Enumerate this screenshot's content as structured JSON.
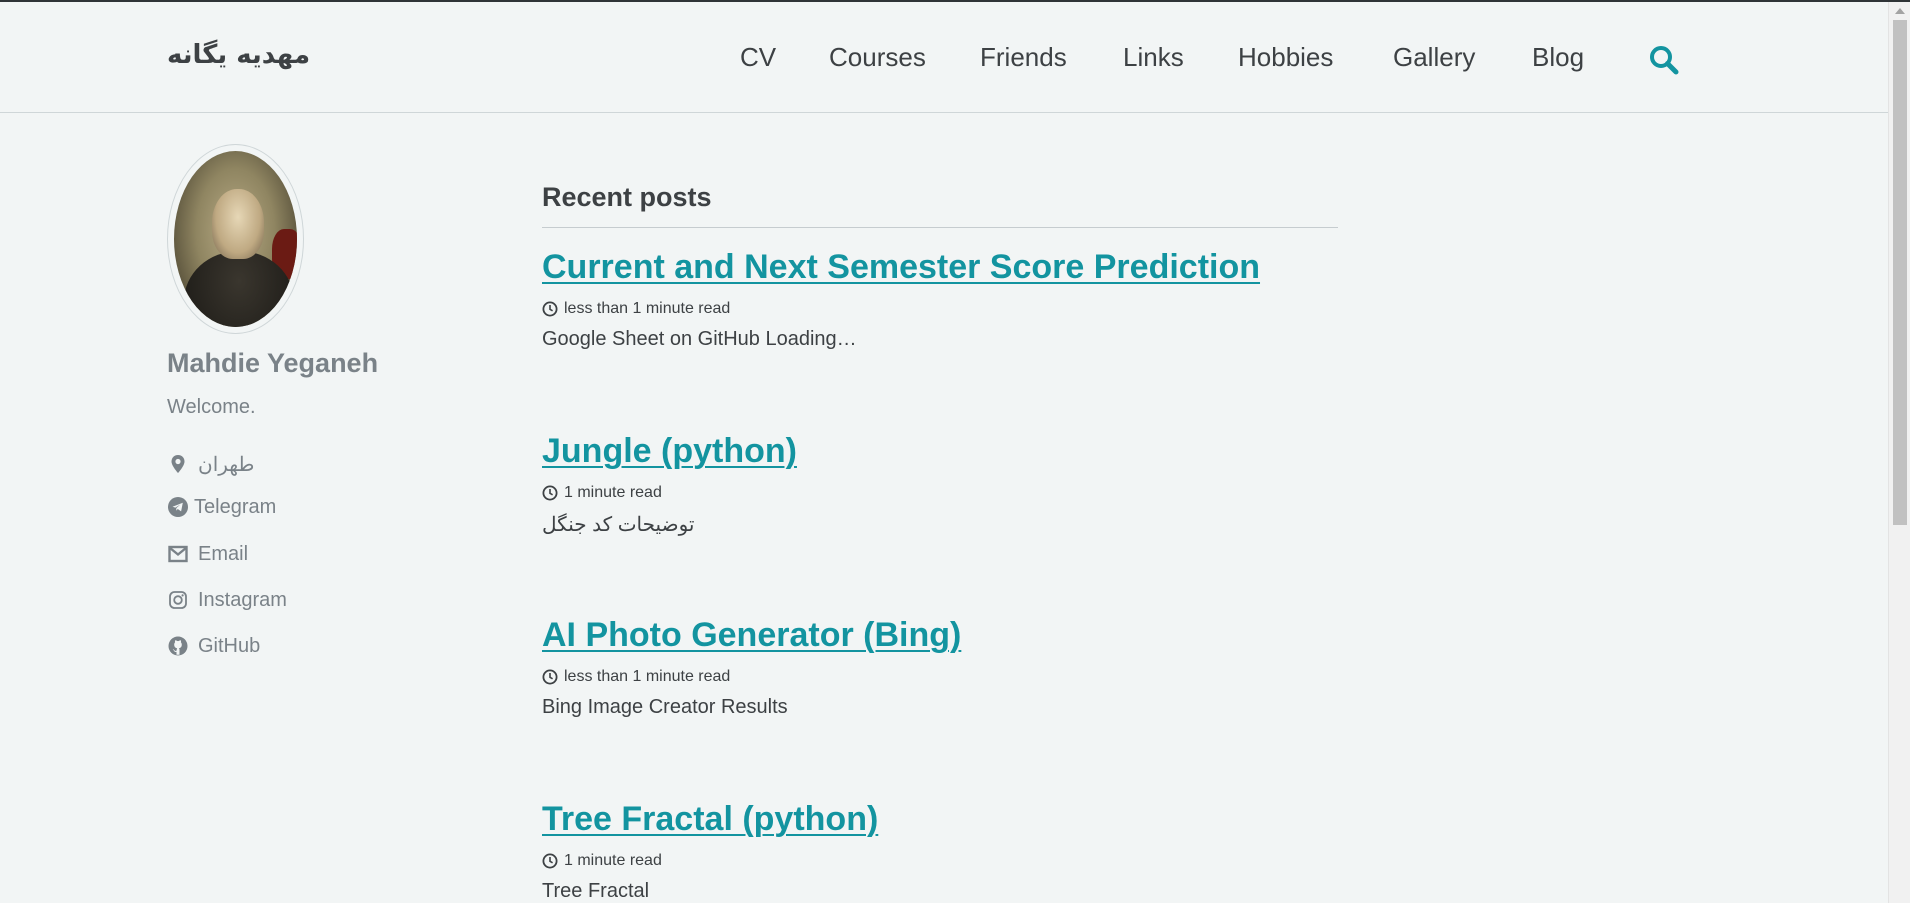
{
  "site": {
    "title": "مهدیه یگانه"
  },
  "nav": {
    "items": [
      {
        "label": "CV"
      },
      {
        "label": "Courses"
      },
      {
        "label": "Friends"
      },
      {
        "label": "Links"
      },
      {
        "label": "Hobbies"
      },
      {
        "label": "Gallery"
      },
      {
        "label": "Blog"
      }
    ],
    "search_icon": "search-icon"
  },
  "author": {
    "name": "Mahdie Yeganeh",
    "bio": "Welcome.",
    "links": [
      {
        "icon": "map-marker-icon",
        "label": "طهران"
      },
      {
        "icon": "telegram-icon",
        "label": "Telegram"
      },
      {
        "icon": "envelope-icon",
        "label": "Email"
      },
      {
        "icon": "instagram-icon",
        "label": "Instagram"
      },
      {
        "icon": "github-icon",
        "label": "GitHub"
      }
    ]
  },
  "main": {
    "section_title": "Recent posts",
    "posts": [
      {
        "title": "Current and Next Semester Score Prediction",
        "read_time": "less than 1 minute read",
        "excerpt": "Google Sheet on GitHub Loading…"
      },
      {
        "title": "Jungle (python)",
        "read_time": "1 minute read",
        "excerpt": "توضیحات کد جنگل"
      },
      {
        "title": "AI Photo Generator (Bing)",
        "read_time": "less than 1 minute read",
        "excerpt": "Bing Image Creator Results"
      },
      {
        "title": "Tree Fractal (python)",
        "read_time": "1 minute read",
        "excerpt": "Tree Fractal"
      }
    ]
  },
  "colors": {
    "background": "#f2f5f5",
    "link": "#1394a0",
    "text": "#3d4144",
    "muted": "#7a8288"
  }
}
